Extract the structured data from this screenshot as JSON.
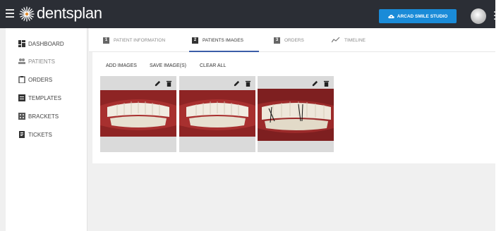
{
  "app": {
    "name": "dentsplan"
  },
  "header": {
    "studio_button": "ARCAD SMILE STUDIO",
    "icons": [
      "menu-icon",
      "logo-icon",
      "cloud-icon",
      "avatar",
      "kebab-icon"
    ]
  },
  "sidebar": {
    "items": [
      {
        "label": "DASHBOARD",
        "icon": "dashboard-icon",
        "active": false
      },
      {
        "label": "PATIENTS",
        "icon": "people-icon",
        "active": true
      },
      {
        "label": "ORDERS",
        "icon": "clipboard-icon",
        "active": false
      },
      {
        "label": "TEMPLATES",
        "icon": "template-icon",
        "active": false
      },
      {
        "label": "BRACKETS",
        "icon": "bracket-icon",
        "active": false
      },
      {
        "label": "TICKETS",
        "icon": "ticket-icon",
        "active": false
      }
    ]
  },
  "tabs": [
    {
      "num": "1",
      "label": "PATIENT INFORMATION",
      "active": false
    },
    {
      "num": "2",
      "label": "PATIENTS IMAGES",
      "active": true
    },
    {
      "num": "3",
      "label": "ORDERS",
      "active": false
    },
    {
      "num": "",
      "label": "TIMELINE",
      "active": false,
      "icon": "timeline-icon"
    }
  ],
  "actions": {
    "add": "ADD IMAGES",
    "save": "SAVE IMAGE(S)",
    "clear": "CLEAR ALL"
  },
  "images": [
    {
      "type": "smile-frontal"
    },
    {
      "type": "smile-frontal"
    },
    {
      "type": "smile-markup"
    }
  ],
  "colors": {
    "topbar": "#2b2e35",
    "accent": "#1a8bd8",
    "tab_underline": "#3b5da8"
  }
}
